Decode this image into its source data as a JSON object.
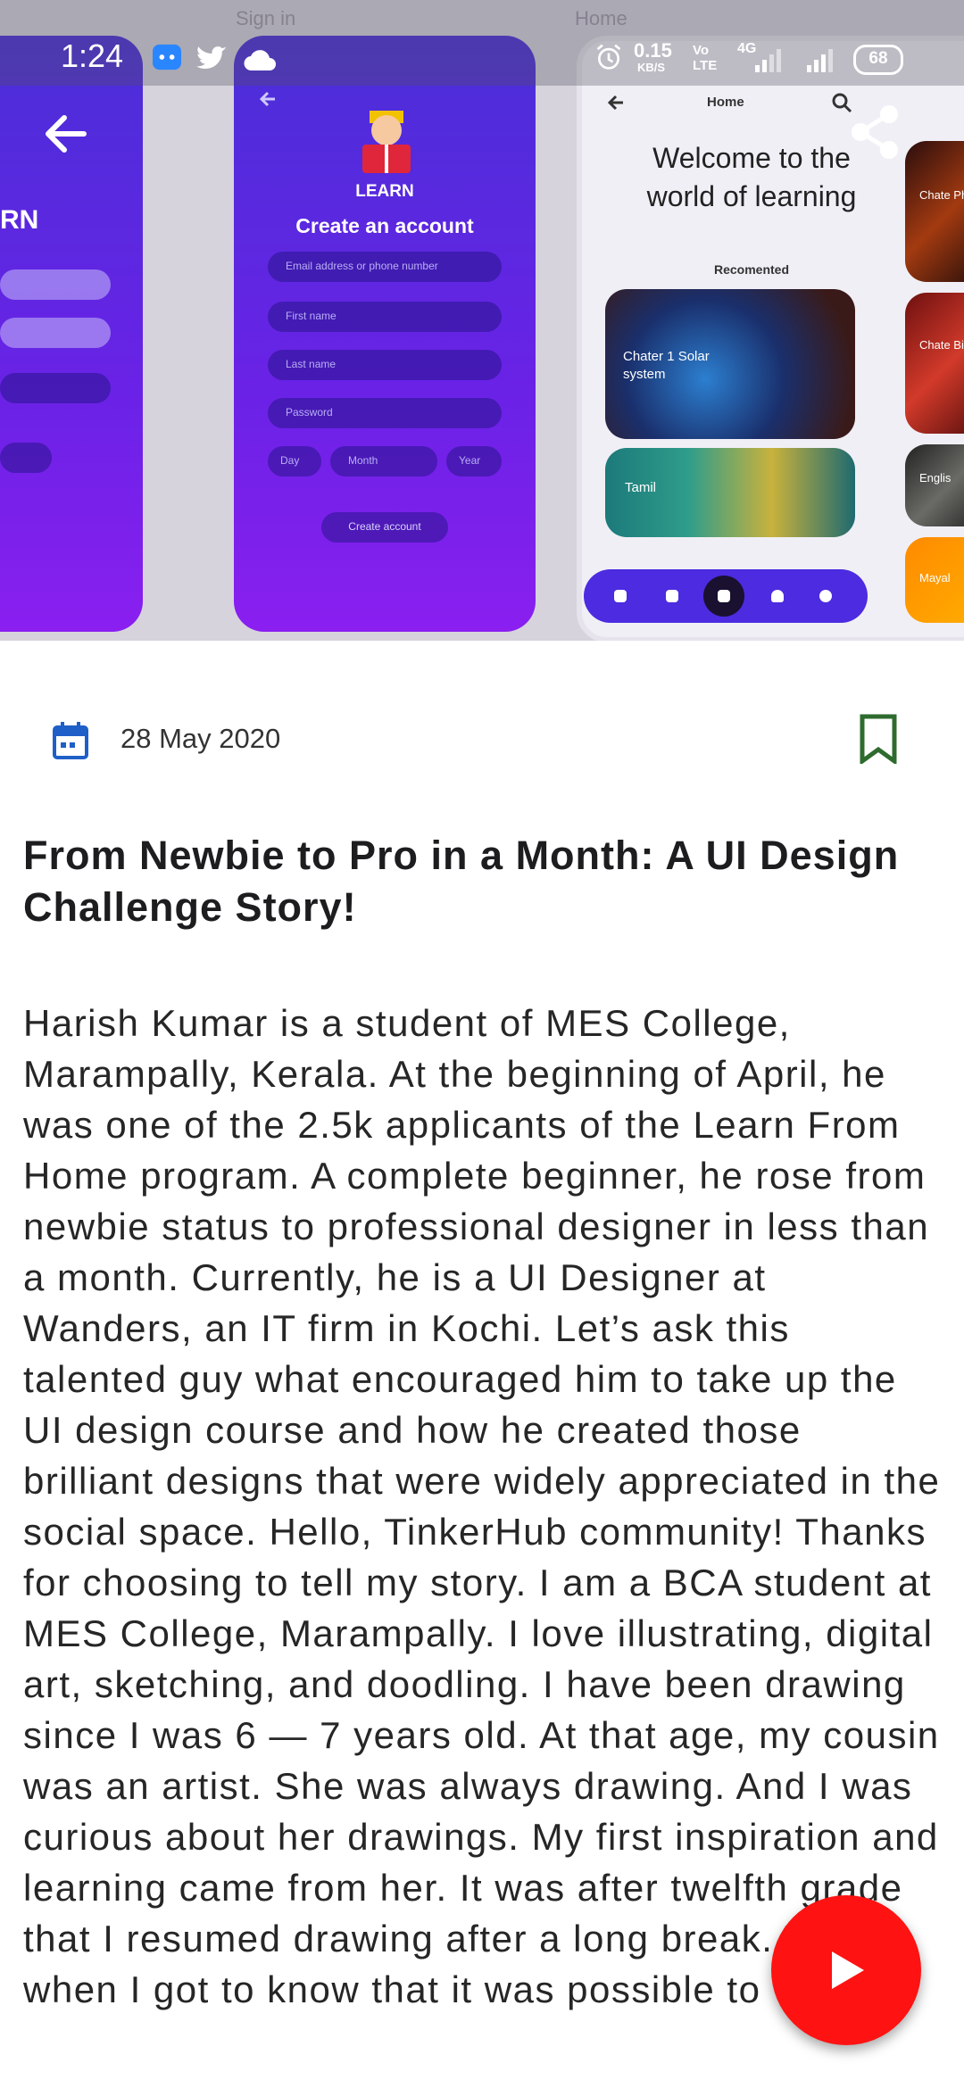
{
  "status_bar": {
    "time": "1:24",
    "network_speed": "0.15",
    "network_unit": "KB/S",
    "volte": "Vo LTE",
    "network_type": "4G",
    "battery": "68"
  },
  "hero": {
    "ghost_left": "Sign in",
    "ghost_right": "Home",
    "left_phone_word": "RN",
    "mid_brand": "LEARN",
    "mid_title": "Create an account",
    "mid_fields": [
      "Email address or phone number",
      "First name",
      "Last name",
      "Password"
    ],
    "mid_dob": [
      "Day",
      "Month",
      "Year"
    ],
    "mid_button": "Create account",
    "right_header": "Home",
    "right_welcome": "Welcome to the world of learning",
    "right_section": "Recomented",
    "right_card1": "Chater 1 Solar system",
    "right_card2": "Tamil",
    "right_side": [
      "Chate Physic",
      "Chate Biolog",
      "Englis",
      "Mayal"
    ]
  },
  "article": {
    "date": "28 May 2020",
    "title": "From Newbie to Pro in a Month: A UI Design Challenge Story!",
    "body": "Harish Kumar is a student of MES College, Marampally, Kerala. At the beginning of April, he was one of the 2.5k applicants of the Learn From Home program. A complete beginner, he rose from newbie status to professional designer in less than a month. Currently, he is a UI Designer at Wanders, an IT firm in Kochi. Let’s ask this talented guy what encouraged him to take up the UI design course and how he created those brilliant designs that were widely appreciated in the social space. Hello, TinkerHub community! Thanks for choosing to tell my story. I am a BCA student at MES College, Marampally. I love illustrating, digital art, sketching, and doodling. I have been drawing since I was 6 — 7 years old. At that age, my cousin was an artist. She was always drawing. And I was curious about her drawings. My first inspiration and learning came from her. It was after twelfth grade that I resumed drawing after a long break. That’s when I got to know that it was possible to"
  },
  "colors": {
    "accent_blue": "#1e5fc8",
    "bookmark_green": "#2e6b2e",
    "fab_red": "#ff1212",
    "hero_purple": "#5a25e0"
  },
  "icons": {
    "back": "arrow-left-icon",
    "share": "share-icon",
    "date": "calendar-icon",
    "bookmark": "bookmark-icon",
    "play": "play-icon"
  }
}
